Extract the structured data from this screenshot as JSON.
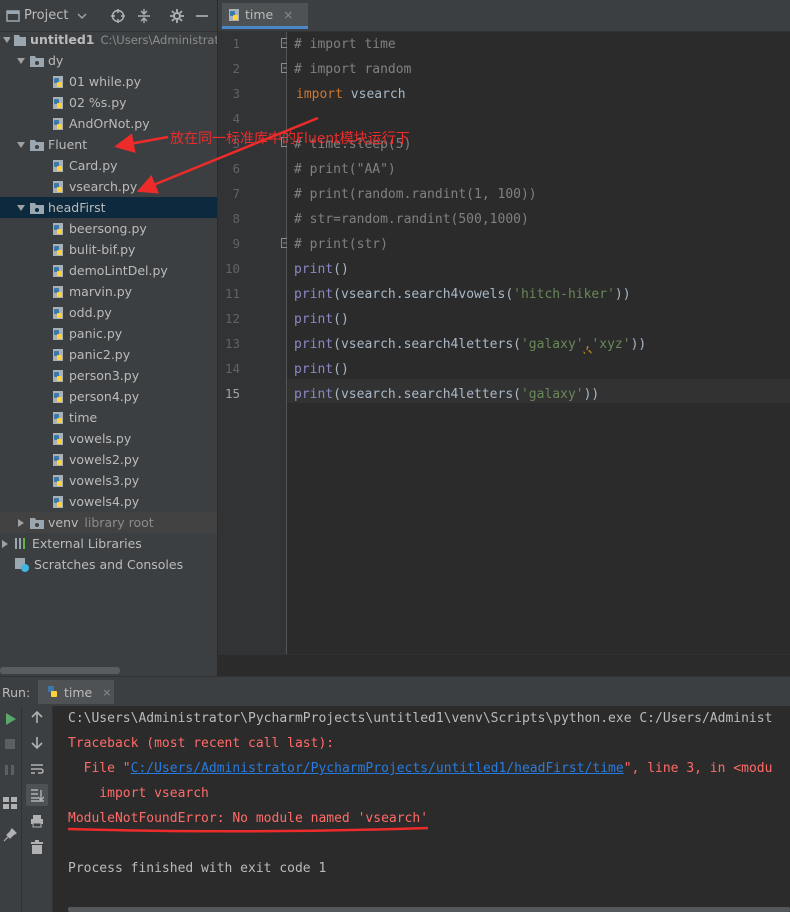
{
  "project_panel": {
    "title": "Project"
  },
  "tree": {
    "root": {
      "label": "untitled1",
      "path": "C:\\Users\\Administrat"
    },
    "items": [
      {
        "label": "dy"
      },
      {
        "label": "01 while.py"
      },
      {
        "label": "02 %s.py"
      },
      {
        "label": "AndOrNot.py"
      },
      {
        "label": "Fluent"
      },
      {
        "label": "Card.py"
      },
      {
        "label": "vsearch.py"
      },
      {
        "label": "headFirst"
      },
      {
        "label": "beersong.py"
      },
      {
        "label": "bulit-bif.py"
      },
      {
        "label": "demoLintDel.py"
      },
      {
        "label": "marvin.py"
      },
      {
        "label": "odd.py"
      },
      {
        "label": "panic.py"
      },
      {
        "label": "panic2.py"
      },
      {
        "label": "person3.py"
      },
      {
        "label": "person4.py"
      },
      {
        "label": "time"
      },
      {
        "label": "vowels.py"
      },
      {
        "label": "vowels2.py"
      },
      {
        "label": "vowels3.py"
      },
      {
        "label": "vowels4.py"
      }
    ],
    "venv": {
      "label": "venv",
      "hint": "library root"
    },
    "external": {
      "label": "External Libraries"
    },
    "scratches": {
      "label": "Scratches and Consoles"
    }
  },
  "editor": {
    "tab_label": "time",
    "close_glyph": "×",
    "line_numbers": [
      "1",
      "2",
      "3",
      "4",
      "5",
      "6",
      "7",
      "8",
      "9",
      "10",
      "11",
      "12",
      "13",
      "14",
      "15"
    ],
    "code": {
      "l1": "# import time",
      "l2": "# import random",
      "l3_kw": "import",
      "l3_rest": " vsearch",
      "l5": "# time.sleep(5)",
      "l6": "# print(\"AA\")",
      "l7": "# print(random.randint(1, 100))",
      "l8": "# str=random.randint(500,1000)",
      "l9": "# print(str)",
      "print": "print",
      "empty_call": "()",
      "l11_a": "(vsearch.search4vowels(",
      "l11_s": "'hitch-hiker'",
      "l11_b": "))",
      "l13_a": "(vsearch.search4letters(",
      "l13_s1": "'galaxy'",
      "l13_comma": ",",
      "l13_s2": "'xyz'",
      "l13_b": "))",
      "l15_a": "(vsearch.search4letters(",
      "l15_s": "'galaxy'",
      "l15_b": "))"
    }
  },
  "annotation": {
    "text": "放在同一标准库中的Fluent模块运行下",
    "color": "#ee2b2b"
  },
  "run": {
    "label": "Run:",
    "tab_label": "time",
    "close_glyph": "×",
    "console": {
      "cmd": "C:\\Users\\Administrator\\PycharmProjects\\untitled1\\venv\\Scripts\\python.exe C:/Users/Administ",
      "traceback": "Traceback (most recent call last):",
      "file_prefix": "  File \"",
      "file_link": "C:/Users/Administrator/PycharmProjects/untitled1/headFirst/time",
      "file_suffix": "\", line 3, in <modu",
      "import_line": "    import vsearch",
      "error": "ModuleNotFoundError: No module named 'vsearch'",
      "finished": "Process finished with exit code 1"
    }
  },
  "colors": {
    "keyword": "#cc7832",
    "builtin": "#8888c6",
    "string": "#6a8759",
    "comment": "#808080",
    "error": "#ff6b68",
    "link": "#287bde",
    "selection": "#0d293e"
  }
}
